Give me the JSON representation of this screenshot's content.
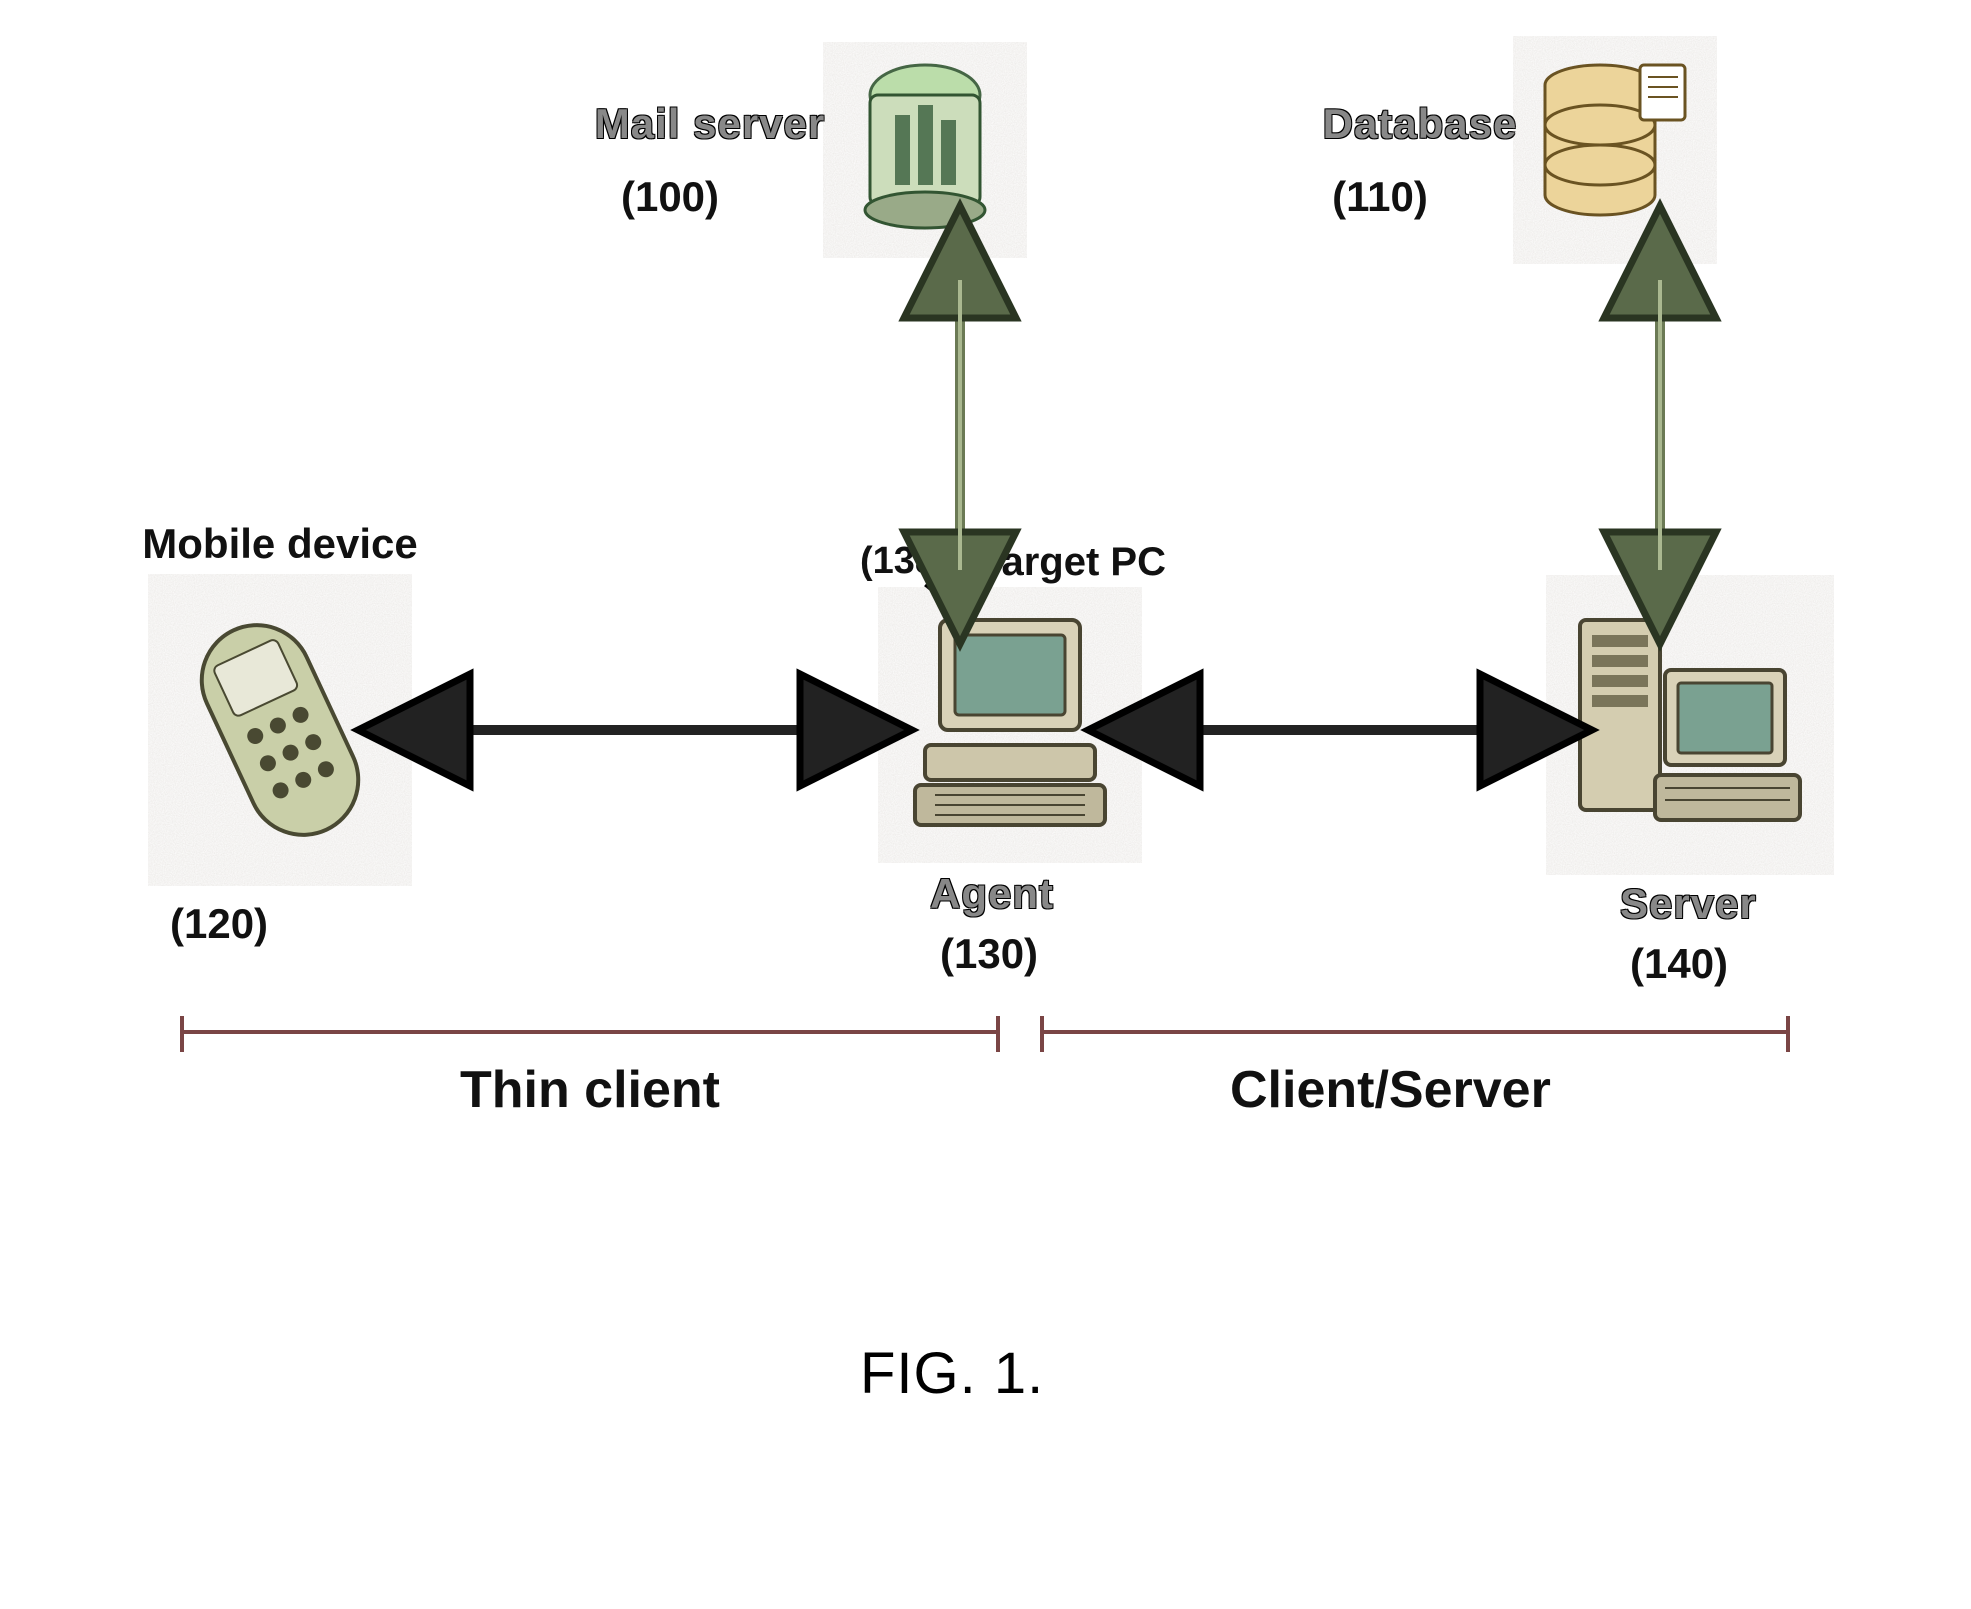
{
  "figure_caption": "FIG. 1.",
  "nodes": {
    "mail_server": {
      "label": "Mail server",
      "ref": "(100)"
    },
    "database": {
      "label": "Database",
      "ref": "(110)"
    },
    "mobile": {
      "label": "Mobile device",
      "ref": "(120)"
    },
    "agent": {
      "label": "Agent",
      "ref": "(130)"
    },
    "target_pc": {
      "label": "Target PC",
      "ref": "(138)"
    },
    "server": {
      "label": "Server",
      "ref": "(140)"
    }
  },
  "segments": {
    "thin_client": "Thin client",
    "client_server": "Client/Server"
  },
  "connections": [
    {
      "from": "mail_server",
      "to": "agent",
      "direction": "bidirectional",
      "axis": "vertical"
    },
    {
      "from": "database",
      "to": "server",
      "direction": "bidirectional",
      "axis": "vertical"
    },
    {
      "from": "mobile",
      "to": "agent",
      "direction": "bidirectional",
      "axis": "horizontal"
    },
    {
      "from": "agent",
      "to": "server",
      "direction": "bidirectional",
      "axis": "horizontal"
    }
  ]
}
